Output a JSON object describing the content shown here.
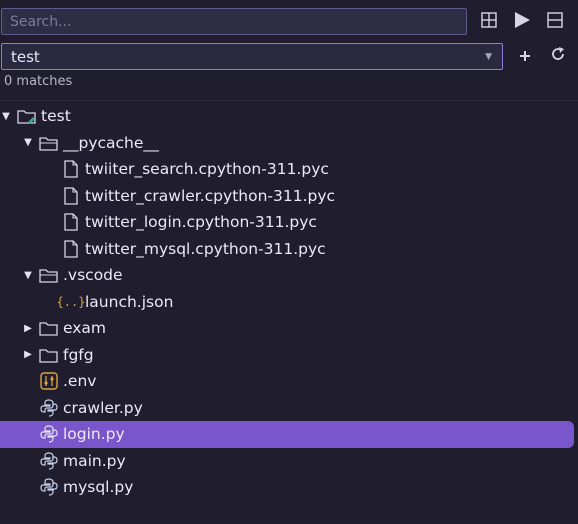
{
  "search": {
    "placeholder": "Search..."
  },
  "toolbar": {
    "layout_icon": "grid-icon",
    "run_icon": "play-icon",
    "panel_icon": "split-panel-icon",
    "add_icon": "plus-icon",
    "refresh_icon": "refresh-icon"
  },
  "project_select": {
    "value": "test"
  },
  "status": {
    "matches": "0 matches"
  },
  "tree": {
    "items": [
      {
        "label": "test",
        "icon": "project-folder-icon",
        "twisty": "open"
      },
      {
        "label": "__pycache__",
        "icon": "folder-open-icon",
        "twisty": "open"
      },
      {
        "label": "twiiter_search.cpython-311.pyc",
        "icon": "file-icon"
      },
      {
        "label": "twitter_crawler.cpython-311.pyc",
        "icon": "file-icon"
      },
      {
        "label": "twitter_login.cpython-311.pyc",
        "icon": "file-icon"
      },
      {
        "label": "twitter_mysql.cpython-311.pyc",
        "icon": "file-icon"
      },
      {
        "label": ".vscode",
        "icon": "folder-open-icon",
        "twisty": "open"
      },
      {
        "label": "launch.json",
        "icon": "json-icon"
      },
      {
        "label": "exam",
        "icon": "folder-icon",
        "twisty": "closed"
      },
      {
        "label": "fgfg",
        "icon": "folder-icon",
        "twisty": "closed"
      },
      {
        "label": ".env",
        "icon": "env-settings-icon"
      },
      {
        "label": "crawler.py",
        "icon": "python-icon"
      },
      {
        "label": "login.py",
        "icon": "python-icon",
        "selected": true
      },
      {
        "label": "main.py",
        "icon": "python-icon"
      },
      {
        "label": "mysql.py",
        "icon": "python-icon"
      }
    ]
  },
  "colors": {
    "background": "#1f1d2e",
    "selection": "#7a56cc",
    "select_border": "#8f7bd8",
    "json_icon": "#d9a441"
  }
}
